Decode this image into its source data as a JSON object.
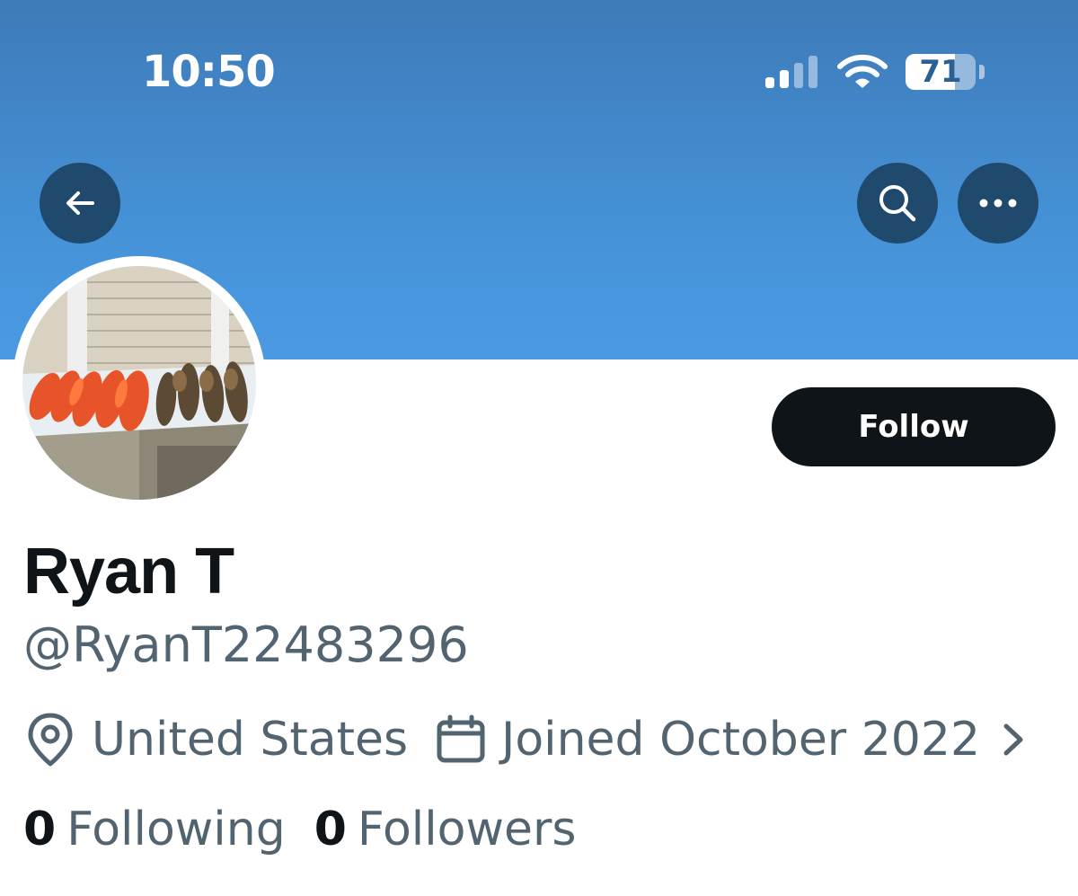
{
  "status_bar": {
    "time": "10:50",
    "battery_level": "71",
    "battery_fraction": 0.71
  },
  "header": {
    "back_icon": "arrow-left-icon",
    "search_icon": "search-icon",
    "more_icon": "more-horizontal-icon",
    "banner_color": "#4591d6"
  },
  "profile": {
    "avatar_description_icon": "avatar-photo",
    "follow_label": "Follow",
    "display_name": "Ryan T",
    "handle": "@RyanT22483296",
    "location": "United States",
    "location_icon": "location-pin-icon",
    "joined": "Joined October 2022",
    "calendar_icon": "calendar-icon",
    "chevron_icon": "chevron-right-icon",
    "following_count": "0",
    "following_label": "Following",
    "followers_count": "0",
    "followers_label": "Followers"
  },
  "colors": {
    "text_primary": "#0f1419",
    "text_secondary": "#536471",
    "button_dark": "#0f1419",
    "header_button": "#1f4a6e"
  }
}
